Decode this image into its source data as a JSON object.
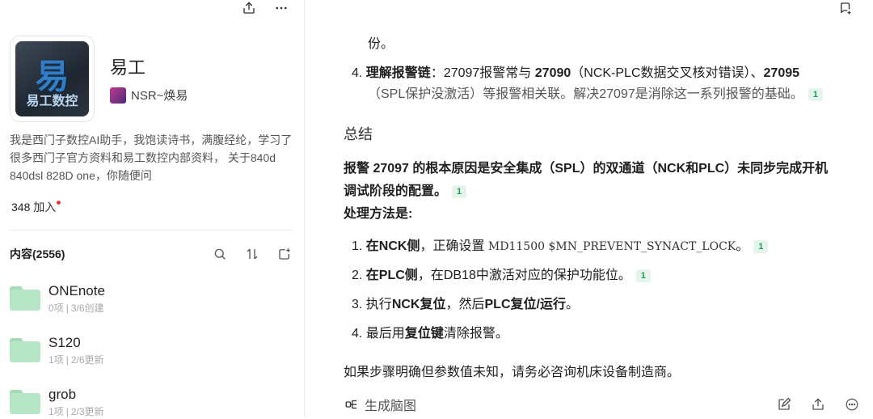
{
  "left": {
    "avatar_big": "易",
    "avatar_small": "易工数控",
    "bot_name": "易工",
    "author": "NSR~焕易",
    "description": "我是西门子数控AI助手，我饱读诗书，满腹经纶，学习了很多西门子官方资料和易工数控内部资料， 关于840d 840dsl 828D one，你随便问",
    "members_count": "348",
    "members_label": "加入",
    "content_title": "内容(2556)",
    "folders": [
      {
        "name": "ONEnote",
        "count": "0项",
        "date": "3/6创建"
      },
      {
        "name": "S120",
        "count": "1项",
        "date": "2/6更新"
      },
      {
        "name": "grob",
        "count": "1项",
        "date": "2/3更新"
      }
    ]
  },
  "right": {
    "top_partial": "份。",
    "item4_num": "4.",
    "item4_bold": "理解报警链",
    "item4_text1": "：27097报警常与 ",
    "item4_code1": "27090",
    "item4_text2": "（NCK-PLC数据交叉核对错误）、",
    "item4_code2": "27095",
    "item4_line2": "（SPL保护没激活）等报警相关联。解决27097是消除这一系列报警的基础。",
    "badge": "1",
    "section_title": "总结",
    "summary_line1": "报警 27097 的根本原因是安全集成（SPL）的双通道（NCK和PLC）未同步完成开机",
    "summary_line2": "调试阶段的配置。",
    "method_label": "处理方法是:",
    "step1_num": "1.",
    "step1_bold": "在NCK侧",
    "step1_text": "，正确设置 ",
    "step1_code": "MD11500 $MN_PREVENT_SYNACT_LOCK",
    "step1_end": "。",
    "step2_num": "2.",
    "step2_bold": "在PLC侧",
    "step2_text": "，在DB18中激活对应的保护功能位。",
    "step3_num": "3.",
    "step3_pre": "执行",
    "step3_bold1": "NCK复位",
    "step3_mid": "，然后",
    "step3_bold2": "PLC复位/运行",
    "step3_end": "。",
    "step4_num": "4.",
    "step4_pre": "最后用",
    "step4_bold": "复位键",
    "step4_end": "清除报警。",
    "footer_note": "如果步骤明确但参数值未知，请务必咨询机床设备制造商。",
    "mindmap_label": "生成脑图"
  },
  "icons": {
    "share": "share-icon",
    "more": "more-icon",
    "search": "search-icon",
    "sort": "sort-icon",
    "add_folder": "add-folder-icon",
    "note_add": "note-add-icon",
    "mindmap": "mindmap-icon",
    "edit": "edit-icon"
  },
  "colors": {
    "accent_green": "#1f9d55",
    "badge_bg": "#e6f5ec",
    "folder_green": "#b7e6c6"
  }
}
